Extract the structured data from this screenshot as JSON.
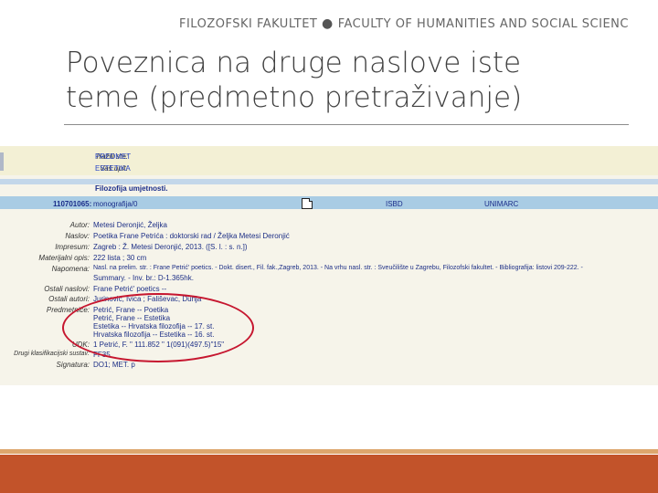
{
  "header": {
    "left": "FILOZOFSKI FAKULTET",
    "right": "FACULTY OF HUMANITIES AND SOCIAL SCIENCES"
  },
  "slide": {
    "title_line1": "Poveznica na druge naslove iste",
    "title_line2": "teme (predmetno pretraživanje)"
  },
  "catalog": {
    "search": {
      "field_label": "Tražili ste:",
      "field_value": "PREDMET",
      "query_label": "Vaš upit:",
      "query_value": "ESTETIKA"
    },
    "work_title": "Filozofija umjetnosti.",
    "record": {
      "id": "110701065:",
      "type": "monografija/0",
      "isbd": "ISBD",
      "unimarc": "UNIMARC"
    },
    "fields": [
      {
        "label": "Autor:",
        "value": "Metesi Deronjić, Željka"
      },
      {
        "label": "Naslov:",
        "value": "Poetika Frane Petrića : doktorski rad / Željka Metesi Deronjić"
      },
      {
        "label": "Impresum:",
        "value": "Zagreb : Ž. Metesi Deronjić, 2013. ([S. l. : s. n.])"
      },
      {
        "label": "Materijalni opis:",
        "value": "222 lista ; 30 cm"
      },
      {
        "label": "Napomena:",
        "value": "Nasl. na prelim. str. : Frane Petrić' poetics. - Dokt. disert., Fil. fak.,Zagreb, 2013. - Na vrhu nasl. str. : Sveučilište u Zagrebu, Filozofski fakultet. - Bibliografija: listovi 209-222. -"
      },
      {
        "label": "",
        "value": "Summary. - Inv. br.: D-1.365hk."
      },
      {
        "label": "Ostali naslovi:",
        "value": "Frane Petrić' poetics --"
      },
      {
        "label": "Ostali autori:",
        "value": "Jurinović, Ivica ; Fališevac, Dunja"
      },
      {
        "label": "Predmetnice:",
        "value": "Petrić, Frane -- Poetika"
      },
      {
        "label": "",
        "value": "Petrić, Frane -- Estetika"
      },
      {
        "label": "",
        "value": "Estetika -- Hrvatska filozofija -- 17. st."
      },
      {
        "label": "",
        "value": "Hrvatska filozofija -- Estetika -- 16. st."
      },
      {
        "label": "UDK:",
        "value": "1 Petrić, F. \" 111.852 \" 1(091)(497.5)\"15\""
      },
      {
        "label": "Drugi klasifikacijski sustav:",
        "value": "FF35"
      },
      {
        "label": "Signatura:",
        "value": "DO1; MET. p"
      }
    ]
  },
  "colors": {
    "annotation_circle": "#c6162f",
    "footer_bar": "#c2532a",
    "footer_line": "#dda66d"
  }
}
